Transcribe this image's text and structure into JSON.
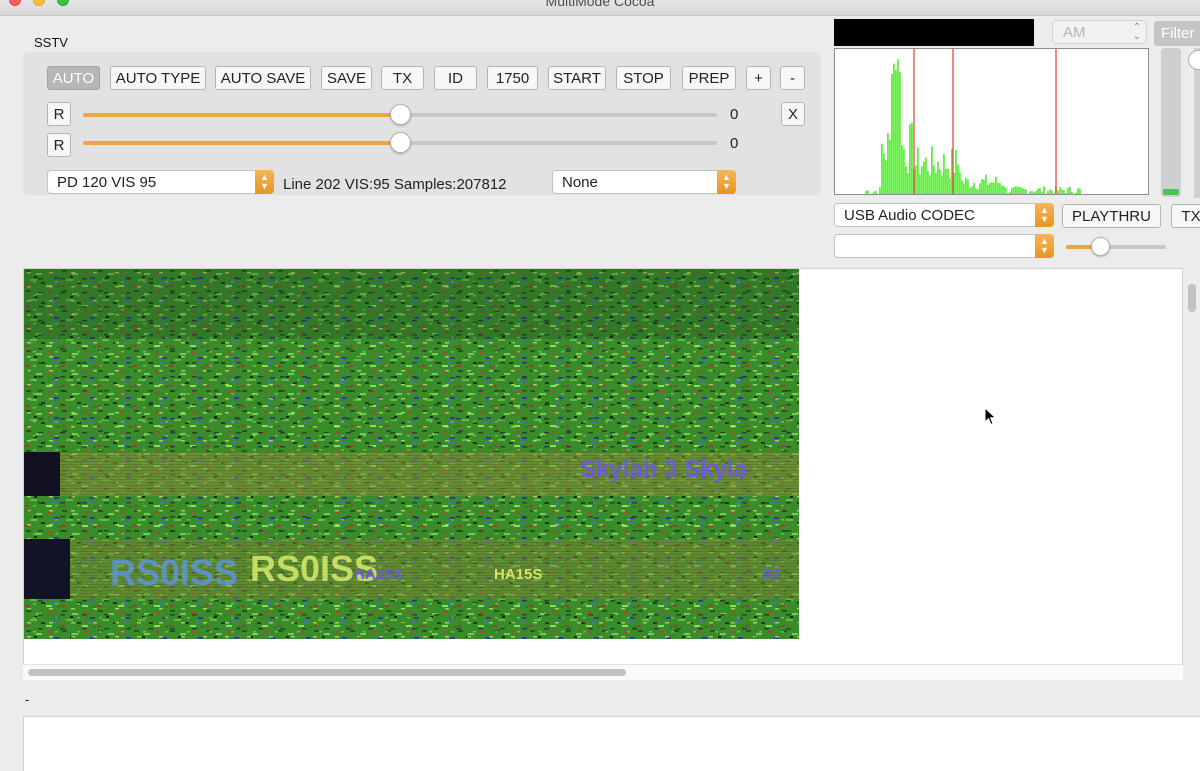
{
  "window": {
    "title": "MultiMode Cocoa"
  },
  "section_label": "SSTV",
  "toolbar": [
    {
      "label": "AUTO",
      "active": true
    },
    {
      "label": "AUTO TYPE"
    },
    {
      "label": "AUTO SAVE"
    },
    {
      "label": "SAVE"
    },
    {
      "label": "TX"
    },
    {
      "label": "ID"
    },
    {
      "label": "1750"
    },
    {
      "label": "START"
    },
    {
      "label": "STOP"
    },
    {
      "label": "PREP"
    },
    {
      "label": "+"
    },
    {
      "label": "-"
    }
  ],
  "x_button": "X",
  "sliders": [
    {
      "reset_label": "R",
      "value": "0",
      "level": 0.5
    },
    {
      "reset_label": "R",
      "value": "0",
      "level": 0.5
    }
  ],
  "mode_select": {
    "value": "PD 120  VIS 95"
  },
  "status": "Line 202  VIS:95 Samples:207812",
  "option_select": {
    "value": "None"
  },
  "mode_popup": {
    "value": "AM"
  },
  "filter_button": "Filter",
  "audio_device_select": {
    "value": "USB Audio CODEC"
  },
  "playthru_button": "PLAYTHRU",
  "tx_button_right": "TX",
  "second_device_select": {
    "value": ""
  },
  "gain_level": 0.34,
  "input_level": 0.04,
  "image_overlay_text": {
    "line1": "Skylab 3 Skyla",
    "callsign1": "RS0ISS",
    "callsign2": "RS0ISS",
    "small1": "HA15S",
    "small2": "HA15S",
    "edge": "ST"
  },
  "dash_label": "-",
  "colors": {
    "accent": "#f0a53a",
    "spectrum": "#5df03c",
    "marker": "#e43b2f",
    "image_green": "#3b8f2a"
  }
}
